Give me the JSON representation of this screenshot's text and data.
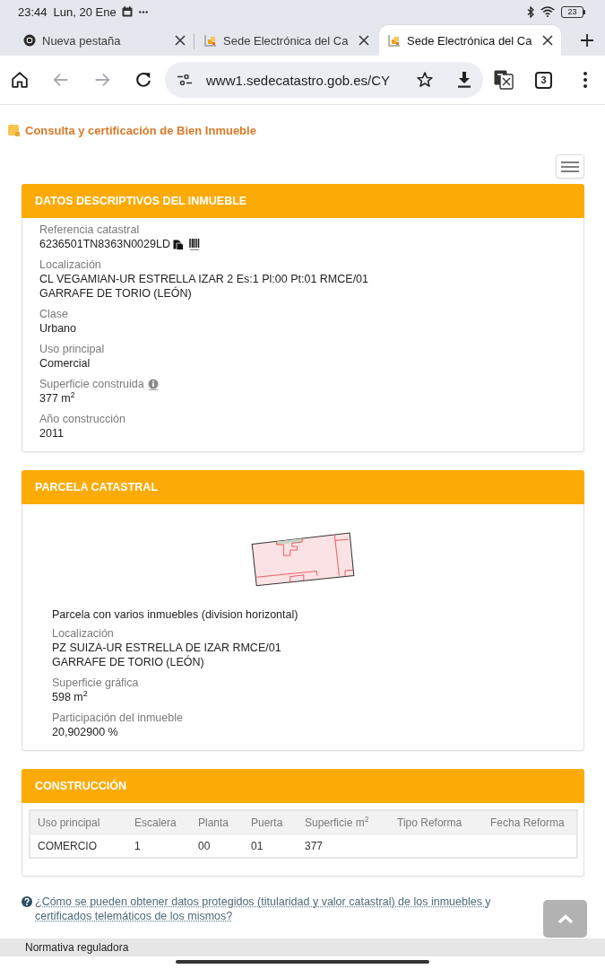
{
  "status_bar": {
    "time": "23:44",
    "date": "Lun, 20 Ene",
    "battery": "23"
  },
  "tabs": [
    {
      "title": "Nueva pestaña",
      "kind": "blank",
      "selected": false
    },
    {
      "title": "Sede Electrónica del Ca",
      "kind": "site",
      "selected": false
    },
    {
      "title": "Sede Electrónica del Ca",
      "kind": "site",
      "selected": true
    }
  ],
  "toolbar": {
    "nav_buttons": [
      {
        "kind": "home",
        "disabled": false
      },
      {
        "kind": "back",
        "disabled": true
      },
      {
        "kind": "forward",
        "disabled": true
      },
      {
        "kind": "reload",
        "disabled": false
      }
    ],
    "url": "www1.sedecatastro.gob.es/CY",
    "tab_count": "3"
  },
  "page_title": "Consulta y certificación de Bien Inmueble",
  "sections": [
    {
      "kind": "fields",
      "header": "DATOS DESCRIPTIVOS DEL INMUEBLE",
      "fields": [
        {
          "kind": "reference",
          "label": "Referencia catastral",
          "lines": [
            "6236501TN8363N0029LD"
          ]
        },
        {
          "kind": "plain",
          "label": "Localización",
          "lines": [
            "CL VEGAMIAN-UR ESTRELLA IZAR 2 Es:1 Pl:00 Pt:01 RMCE/01",
            "GARRAFE DE TORIO (LEÓN)"
          ]
        },
        {
          "kind": "plain",
          "label": "Clase",
          "lines": [
            "Urbano"
          ]
        },
        {
          "kind": "plain",
          "label": "Uso principal",
          "lines": [
            "Comercial"
          ]
        },
        {
          "kind": "info",
          "label": "Superficie construida",
          "lines": [
            "377 m$^{2}$"
          ]
        },
        {
          "kind": "plain",
          "label": "Año construcción",
          "lines": [
            "2011"
          ]
        }
      ]
    },
    {
      "kind": "parcel",
      "header": "PARCELA CATASTRAL",
      "note": "Parcela con varios inmuebles (division horizontal)",
      "fields": [
        {
          "kind": "plain",
          "label": "Localización",
          "lines": [
            "PZ SUIZA-UR ESTRELLA DE IZAR RMCE/01",
            "GARRAFE DE TORIO (LEÓN)"
          ]
        },
        {
          "kind": "plain",
          "label": "Superficie gráfica",
          "lines": [
            "598 m$^{2}$"
          ]
        },
        {
          "kind": "plain",
          "label": "Participación del inmueble",
          "lines": [
            "20,902900 %"
          ]
        }
      ]
    },
    {
      "kind": "table",
      "header": "CONSTRUCCIÓN",
      "columns": [
        "Uso principal",
        "Escalera",
        "Planta",
        "Puerta",
        "Superficie m$^{2}$",
        "Tipo Reforma",
        "Fecha Reforma"
      ],
      "rows": [
        [
          "COMERCIO",
          "1",
          "00",
          "01",
          "377"
        ]
      ]
    }
  ],
  "help_link": "¿Cómo se pueden obtener datos protegidos (titularidad y valor catastral) de los inmuebles y certificados telemáticos de los mismos?",
  "footer": "Normativa reguladora"
}
